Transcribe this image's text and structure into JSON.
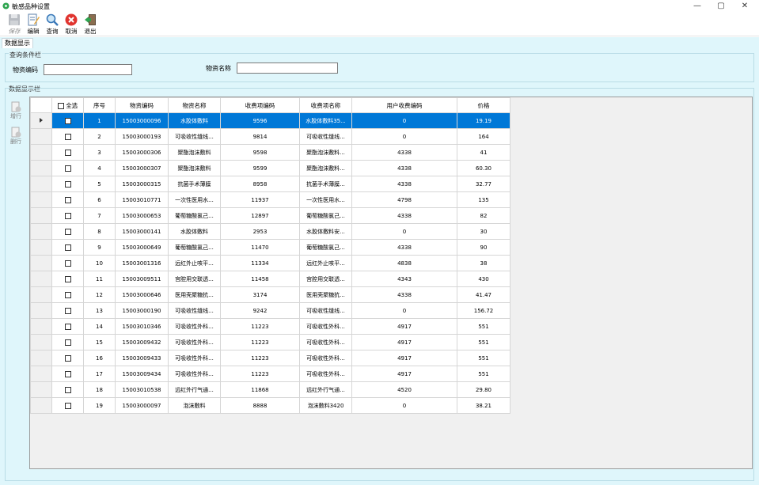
{
  "window": {
    "title": "敏感品种设置",
    "controls": {
      "minimize": "—",
      "maximize": "▢",
      "close": "✕"
    }
  },
  "toolbar": {
    "save_label": "保存",
    "edit_label": "编辑",
    "query_label": "查询",
    "cancel_label": "取消",
    "exit_label": "退出"
  },
  "tabs": {
    "data_display": "数据显示"
  },
  "query": {
    "group_title": "查询条件栏",
    "code_label": "物资编码",
    "code_value": "",
    "name_label": "物资名称",
    "name_value": ""
  },
  "data": {
    "group_title": "数据显示栏",
    "add_row": "增行",
    "delete_row": "删行"
  },
  "grid": {
    "columns": {
      "select_all": "全选",
      "seq": "序号",
      "code": "物资编码",
      "name": "物资名称",
      "fee_code": "收费项编码",
      "fee_name": "收费项名称",
      "user_fee_code": "用户收费编码",
      "price": "价格"
    },
    "rows": [
      {
        "seq": "1",
        "code": "15003000096",
        "name": "水胶体敷料",
        "fee_code": "9596",
        "fee_name": "水胶体敷料35...",
        "user_fee_code": "0",
        "price": "19.19"
      },
      {
        "seq": "2",
        "code": "15003000193",
        "name": "可吸收性缝线...",
        "fee_code": "9814",
        "fee_name": "可吸收性缝线...",
        "user_fee_code": "0",
        "price": "164"
      },
      {
        "seq": "3",
        "code": "15003000306",
        "name": "聚酯泡沫敷料",
        "fee_code": "9598",
        "fee_name": "聚酯泡沫敷料...",
        "user_fee_code": "4338",
        "price": "41"
      },
      {
        "seq": "4",
        "code": "15003000307",
        "name": "聚酯泡沫敷料",
        "fee_code": "9599",
        "fee_name": "聚酯泡沫敷料...",
        "user_fee_code": "4338",
        "price": "60.30"
      },
      {
        "seq": "5",
        "code": "15003000315",
        "name": "抗菌手术薄膜",
        "fee_code": "8958",
        "fee_name": "抗菌手术薄膜...",
        "user_fee_code": "4338",
        "price": "32.77"
      },
      {
        "seq": "6",
        "code": "15003010771",
        "name": "一次性医用水...",
        "fee_code": "11937",
        "fee_name": "一次性医用水...",
        "user_fee_code": "4798",
        "price": "135"
      },
      {
        "seq": "7",
        "code": "15003000653",
        "name": "葡萄糖酸氯己...",
        "fee_code": "12897",
        "fee_name": "葡萄糖酸氯己...",
        "user_fee_code": "4338",
        "price": "82"
      },
      {
        "seq": "8",
        "code": "15003000141",
        "name": "水胶体敷料",
        "fee_code": "2953",
        "fee_name": "水胶体敷料安...",
        "user_fee_code": "0",
        "price": "30"
      },
      {
        "seq": "9",
        "code": "15003000649",
        "name": "葡萄糖酸氯己...",
        "fee_code": "11470",
        "fee_name": "葡萄糖酸氯己...",
        "user_fee_code": "4338",
        "price": "90"
      },
      {
        "seq": "10",
        "code": "15003001316",
        "name": "远红外止咳平...",
        "fee_code": "11334",
        "fee_name": "远红外止咳平...",
        "user_fee_code": "4838",
        "price": "38"
      },
      {
        "seq": "11",
        "code": "15003009511",
        "name": "宫腔用交联透...",
        "fee_code": "11458",
        "fee_name": "宫腔用交联透...",
        "user_fee_code": "4343",
        "price": "430"
      },
      {
        "seq": "12",
        "code": "15003000646",
        "name": "医用壳聚糖抗...",
        "fee_code": "3174",
        "fee_name": "医用壳聚糖抗...",
        "user_fee_code": "4338",
        "price": "41.47"
      },
      {
        "seq": "13",
        "code": "15003000190",
        "name": "可吸收性缝线...",
        "fee_code": "9242",
        "fee_name": "可吸收性缝线...",
        "user_fee_code": "0",
        "price": "156.72"
      },
      {
        "seq": "14",
        "code": "15003010346",
        "name": "可吸收性外科...",
        "fee_code": "11223",
        "fee_name": "可吸收性外科...",
        "user_fee_code": "4917",
        "price": "551"
      },
      {
        "seq": "15",
        "code": "15003009432",
        "name": "可吸收性外科...",
        "fee_code": "11223",
        "fee_name": "可吸收性外科...",
        "user_fee_code": "4917",
        "price": "551"
      },
      {
        "seq": "16",
        "code": "15003009433",
        "name": "可吸收性外科...",
        "fee_code": "11223",
        "fee_name": "可吸收性外科...",
        "user_fee_code": "4917",
        "price": "551"
      },
      {
        "seq": "17",
        "code": "15003009434",
        "name": "可吸收性外科...",
        "fee_code": "11223",
        "fee_name": "可吸收性外科...",
        "user_fee_code": "4917",
        "price": "551"
      },
      {
        "seq": "18",
        "code": "15003010538",
        "name": "远红外行气通...",
        "fee_code": "11868",
        "fee_name": "远红外行气通...",
        "user_fee_code": "4520",
        "price": "29.80"
      },
      {
        "seq": "19",
        "code": "15003000097",
        "name": "泡沫敷料",
        "fee_code": "8888",
        "fee_name": "泡沫敷料3420",
        "user_fee_code": "0",
        "price": "38.21"
      }
    ]
  },
  "colors": {
    "selection": "#0078d7",
    "panel_bg": "#dff6fb",
    "group_border": "#b9dce6"
  }
}
